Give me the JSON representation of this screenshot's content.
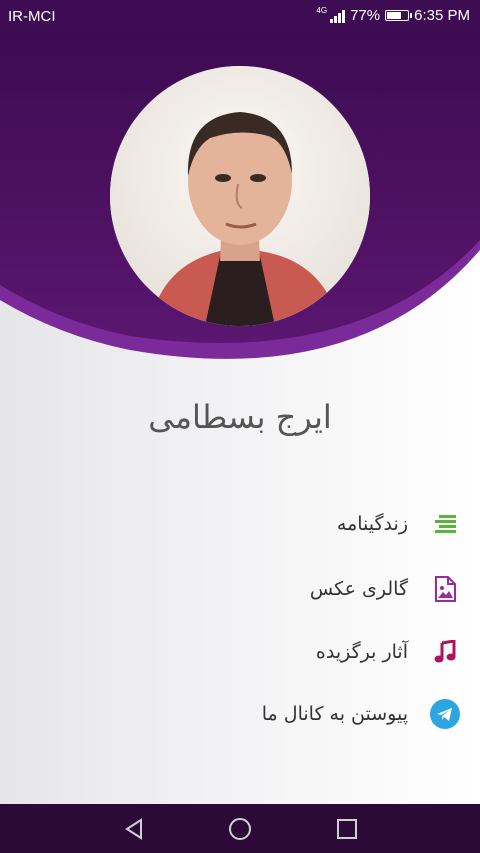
{
  "status_bar": {
    "carrier": "IR-MCI",
    "network": "4G",
    "battery_percent_label": "77%",
    "battery_level": 0.77,
    "time": "6:35 PM"
  },
  "profile": {
    "name": "ایرج بسطامی",
    "photo_icon": "portrait-photo"
  },
  "menu": {
    "items": [
      {
        "label": "زندگینامه",
        "icon": "list-icon",
        "color": "#57b53a"
      },
      {
        "label": "گالری عکس",
        "icon": "gallery-icon",
        "color": "#9b2a9b"
      },
      {
        "label": "آثار برگزیده",
        "icon": "music-note-icon",
        "color": "#b0125f"
      },
      {
        "label": "پیوستن به کانال ما",
        "icon": "telegram-icon",
        "color": "#2ca5e0"
      }
    ]
  },
  "nav_bar": {
    "buttons": [
      "back-icon",
      "home-icon",
      "recents-icon"
    ]
  },
  "colors": {
    "header_dark": "#3e0c52",
    "header_mid": "#6a1b7e",
    "accent": "#7b2a9a"
  }
}
